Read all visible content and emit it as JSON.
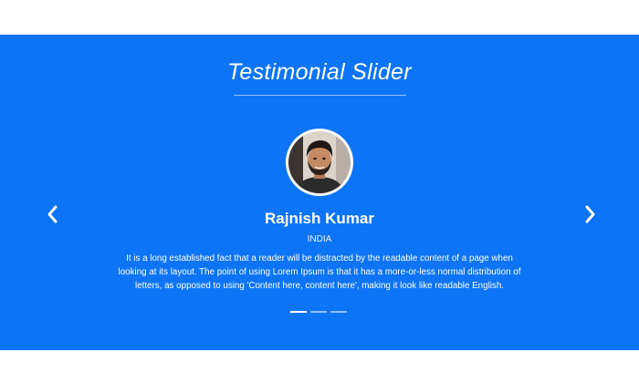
{
  "section": {
    "title": "Testimonial Slider"
  },
  "testimonial": {
    "name": "Rajnish Kumar",
    "country": "INDIA",
    "quote": "It is a long established fact that a reader will be distracted by the readable content of a page when looking at its layout. The point of using Lorem Ipsum is that it has a more-or-less normal distribution of letters, as opposed to using 'Content here, content here', making it look like readable English."
  },
  "slider": {
    "prev_icon": "chevron-left-icon",
    "next_icon": "chevron-right-icon",
    "slide_count": 3,
    "active_slide": 1
  },
  "colors": {
    "background": "#0d74f6",
    "text": "#ffffff"
  }
}
